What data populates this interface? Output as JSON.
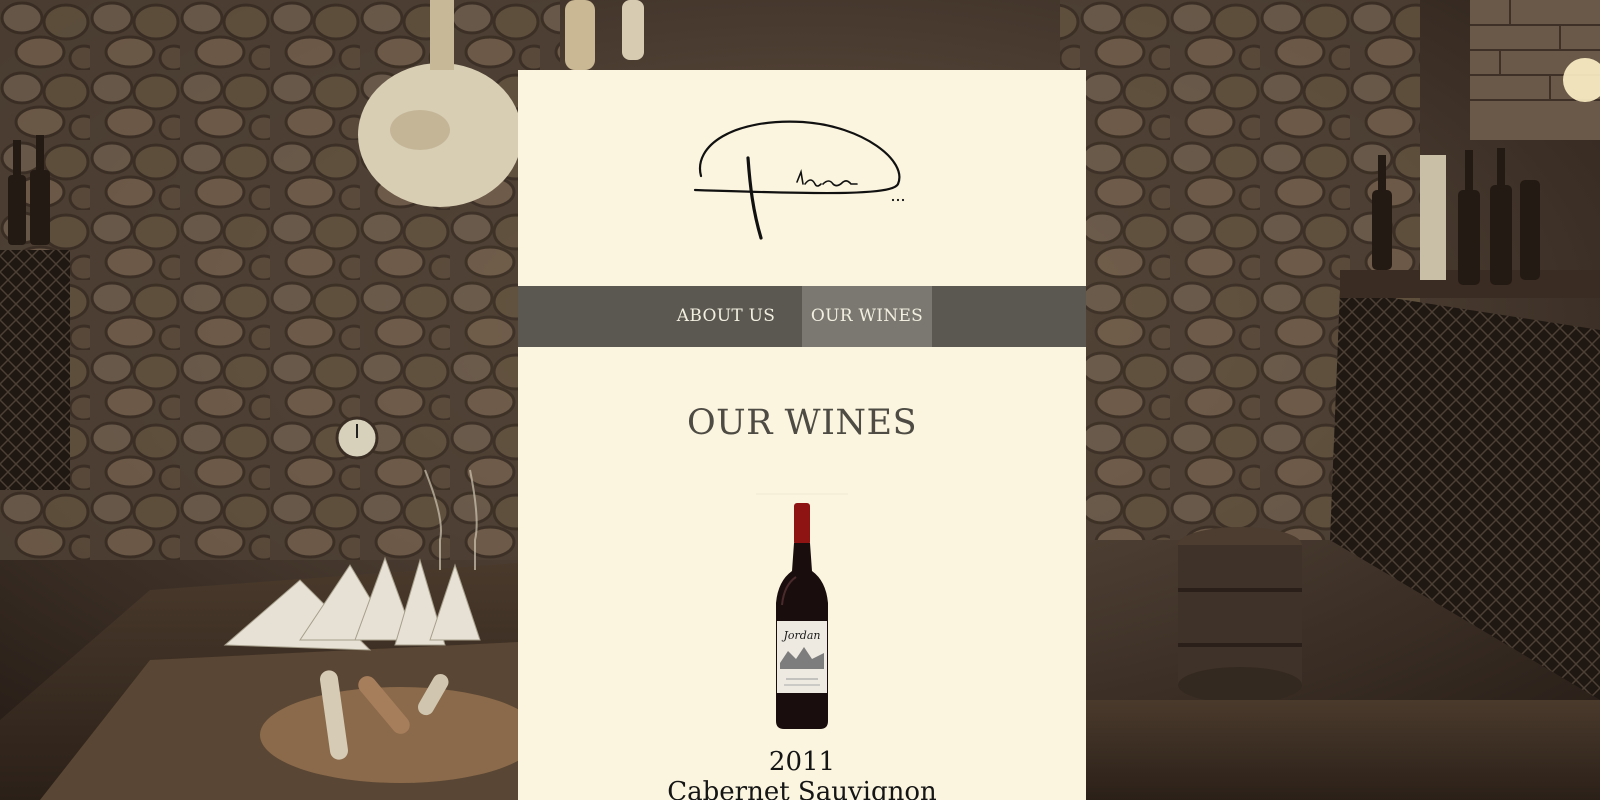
{
  "brand": {
    "logo_signature": "Pithora...",
    "logo_icon": "signature-logo"
  },
  "nav": {
    "items": [
      {
        "label": "ABOUT US",
        "active": false
      },
      {
        "label": "OUR WINES",
        "active": true
      }
    ]
  },
  "main": {
    "heading": "OUR WINES",
    "wines": [
      {
        "year": "2011",
        "name": "Cabernet Sauvignon",
        "label_text": "Jordan",
        "image": "wine-bottle"
      }
    ]
  },
  "colors": {
    "panel_bg": "#fbf5df",
    "nav_bg": "#5a5850",
    "nav_active_bg": "#7a7870",
    "heading_text": "#4d4b43"
  }
}
